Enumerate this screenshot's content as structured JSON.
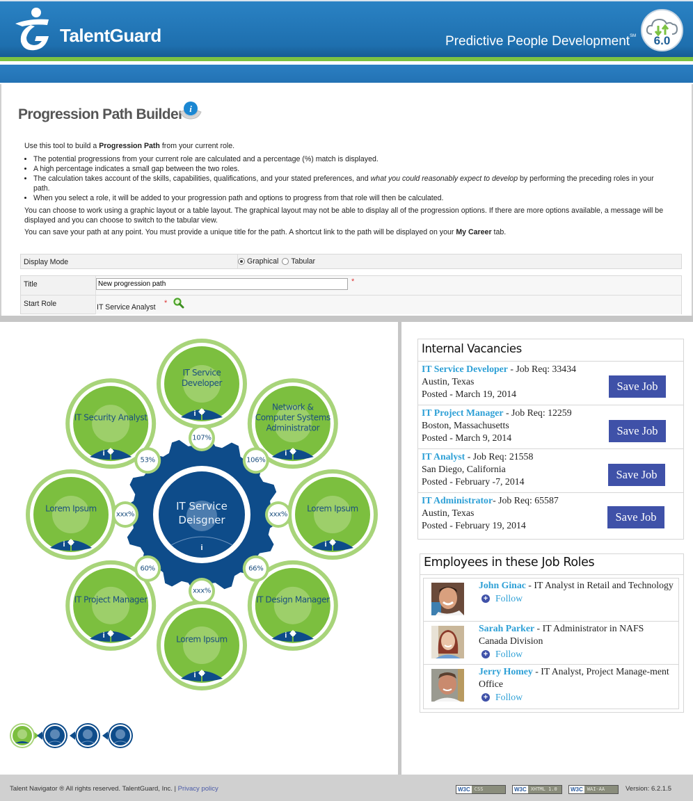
{
  "header": {
    "brand": "TalentGuard",
    "tagline": "Predictive People Development",
    "tagline_mark": "SM",
    "version_badge": "6.0"
  },
  "page": {
    "title": "Progression Path Builder",
    "intro_lead_pre": "Use this tool to build a ",
    "intro_lead_bold": "Progression Path",
    "intro_lead_post": " from your current role.",
    "bullets": [
      "The potential progressions from your current role are calculated and a percentage (%) match is displayed.",
      "A high percentage indicates a small gap between the two roles."
    ],
    "bullet3_pre": "The calculation takes account of the skills, capabilities, qualifications, and your stated preferences, and ",
    "bullet3_italic": "what you could reasonably expect to develop",
    "bullet3_post": " by performing the preceding roles in your path.",
    "bullet4": "When you select a role, it will be added to your progression path and options to progress from that role will then be calculated.",
    "para_layout": "You can choose to work using a graphic layout or a table layout. The graphical layout may not be able to display all of the progression options. If there are more options available, a message will be displayed and you can choose to switch to the tabular view.",
    "para_save_pre": "You can save your path at any point. You must provide a unique title for the path. A shortcut link to the path will be displayed on your ",
    "para_save_bold": "My Career",
    "para_save_post": " tab."
  },
  "form": {
    "display_mode_label": "Display Mode",
    "display_mode_options": [
      "Graphical",
      "Tabular"
    ],
    "display_mode_selected": "Graphical",
    "title_label": "Title",
    "title_value": "New progression path",
    "start_role_label": "Start Role",
    "start_role_value": "IT Service Analyst",
    "required_mark": "*"
  },
  "diagram": {
    "center": {
      "line1": "IT Service",
      "line2": "Deisgner",
      "info": "i"
    },
    "nodes": [
      {
        "label": "IT Service Developer",
        "match": "107%",
        "has_buttons": true
      },
      {
        "label": "Network & Computer Systems Administrator",
        "match": "106%",
        "has_buttons": true
      },
      {
        "label": "Lorem Ipsum",
        "match": "xxx%",
        "has_buttons": true
      },
      {
        "label": "IT Design Manager",
        "match": "66%",
        "has_buttons": true
      },
      {
        "label": "Lorem Ipsum",
        "match": "xxx%",
        "has_buttons": true
      },
      {
        "label": "IT Project Manager",
        "match": "60%",
        "has_buttons": true
      },
      {
        "label": "Lorem Ipsum",
        "match": "xxx%",
        "has_buttons": true
      },
      {
        "label": "IT Security Analyst",
        "match": "53%",
        "has_buttons": true
      }
    ],
    "node_info_label": "i",
    "colors": {
      "green": "#7cbf3f",
      "light_green": "#a8d47a",
      "navy": "#0e4c8a"
    },
    "path_steps": 4,
    "path_active_step": 1
  },
  "vacancies": {
    "title": "Internal Vacancies",
    "items": [
      {
        "role": "IT Service Developer",
        "req": " - Job Req: 33434",
        "location": "Austin, Texas",
        "posted": "Posted - March 19, 2014",
        "button": "Save Job"
      },
      {
        "role": "IT Project Manager",
        "req": " - Job Req: 12259",
        "location": "Boston, Massachusetts",
        "posted": "Posted - March 9, 2014",
        "button": "Save Job"
      },
      {
        "role": "IT Analyst",
        "req": " - Job Req: 21558",
        "location": "San Diego, California",
        "posted": "Posted - February -7, 2014",
        "button": "Save Job"
      },
      {
        "role": "IT Administrator",
        "req": "- Job Req: 65587",
        "location": "Austin, Texas",
        "posted": "Posted - February 19, 2014",
        "button": "Save Job"
      }
    ]
  },
  "employees": {
    "title": "Employees in these Job Roles",
    "items": [
      {
        "name": "John Ginac",
        "desc": " - IT Analyst in Retail and Technology",
        "follow": "Follow"
      },
      {
        "name": "Sarah Parker",
        "desc": " - IT Administrator in NAFS Canada Division",
        "follow": "Follow"
      },
      {
        "name": "Jerry Homey",
        "desc": " - IT Analyst, Project Manage-ment Office",
        "follow": "Follow"
      }
    ]
  },
  "footer": {
    "copyright": "Talent Navigator ® All rights reserved. TalentGuard, Inc. | ",
    "privacy": "Privacy policy",
    "badges": [
      {
        "w3c": "W3C",
        "text": "CSS"
      },
      {
        "w3c": "W3C",
        "text": "XHTML 1.0"
      },
      {
        "w3c": "W3C",
        "text": "WAI-AA"
      }
    ],
    "version": "Version: 6.2.1.5"
  }
}
